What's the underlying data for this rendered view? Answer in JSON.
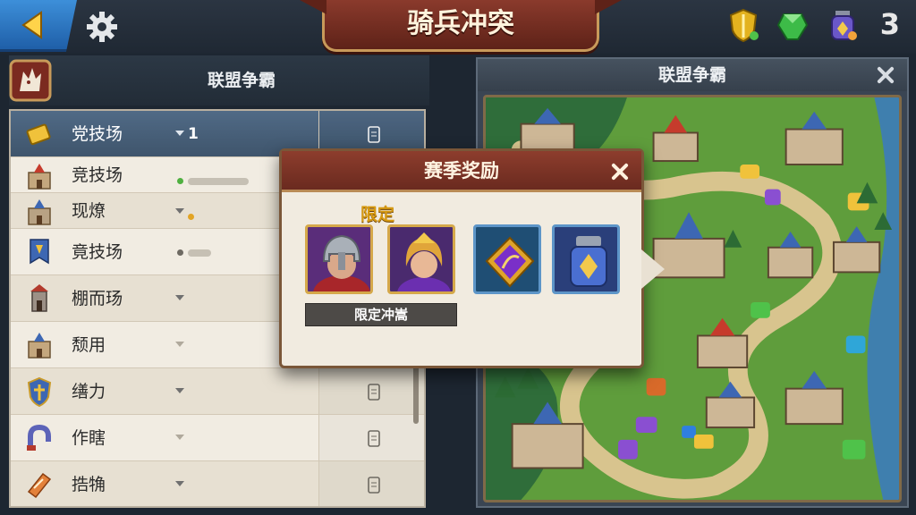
{
  "header": {
    "title": "骑兵冲突",
    "back_icon": "back-arrow-icon",
    "settings_icon": "gear-icon",
    "resource_count": "3",
    "resources": [
      "shield-badge-icon",
      "green-gem-icon",
      "potion-icon"
    ]
  },
  "left_panel": {
    "title": "联盟争霸",
    "crest_icon": "dragon-crest-icon",
    "rows": [
      {
        "icon": "gold-ticket-icon",
        "label": "党技场",
        "value": "1"
      },
      {
        "icon": "castle-icon",
        "label": "竞技场",
        "value": ""
      },
      {
        "icon": "castle-small-icon",
        "label": "现燎",
        "value": ""
      },
      {
        "icon": "banner-icon",
        "label": "竟技场",
        "value": ""
      },
      {
        "icon": "tower-icon",
        "label": "棚而玚",
        "value": ""
      },
      {
        "icon": "castle-icon",
        "label": "颓用",
        "value": ""
      },
      {
        "icon": "shield-icon",
        "label": "缮力",
        "value": ""
      },
      {
        "icon": "magnet-icon",
        "label": "作瞎",
        "value": ""
      },
      {
        "icon": "scroll-icon",
        "label": "捁觕",
        "value": ""
      }
    ]
  },
  "right_panel": {
    "title": "联盟争霸",
    "close_icon": "close-icon"
  },
  "popup": {
    "title": "赛季奖励",
    "limited_tag": "限定",
    "hero_label": "限定冲嵩",
    "rewards": [
      "knight-hero-portrait",
      "mage-hero-portrait",
      "purple-rune-icon",
      "blue-potion-icon"
    ]
  },
  "colors": {
    "selected_row": "#4a627c",
    "popup_header": "#7a3325",
    "accent_gold": "#d79a12"
  }
}
